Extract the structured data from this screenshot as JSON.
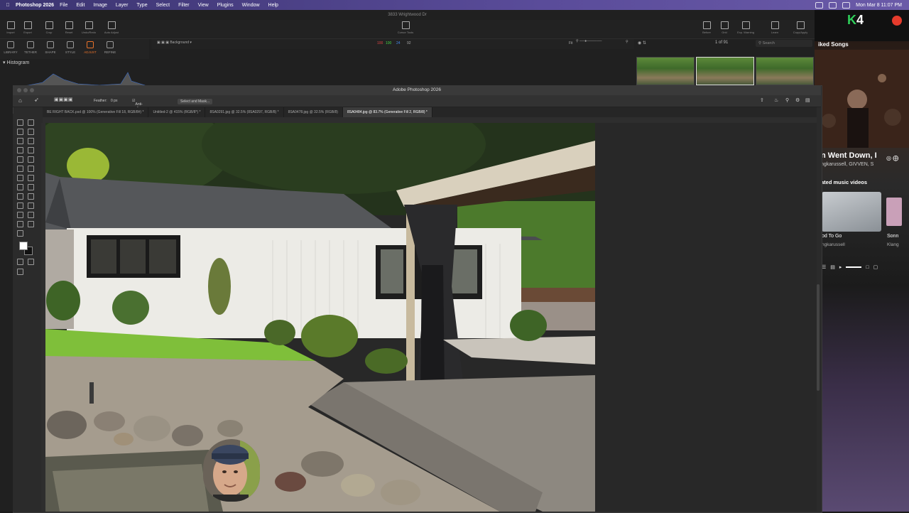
{
  "menubar": {
    "app_name": "Photoshop 2026",
    "items": [
      "File",
      "Edit",
      "Image",
      "Layer",
      "Type",
      "Select",
      "Filter",
      "View",
      "Plugins",
      "Window",
      "Help"
    ],
    "clock": "Mon Mar 8  11:07 PM"
  },
  "bg_app": {
    "title": "3833 Wrightwood Dr",
    "toolbar_left": [
      "Import",
      "Export",
      "Crop",
      "Reset",
      "Undo/Redo",
      "Auto Adjust"
    ],
    "toolbar_center": "Cursor Tools",
    "toolbar_right": [
      "Before",
      "Grid",
      "Exp. Warning",
      "Learn",
      "Copy/Apply"
    ],
    "tabs": [
      "LIBRARY",
      "TETHER",
      "SHAPE",
      "STYLE",
      "ADJUST",
      "REFINE"
    ],
    "active_tab": "ADJUST",
    "histogram_label": "Histogram",
    "layer_label": "Background",
    "rgb_readout": [
      "100",
      "100",
      "24",
      "92"
    ],
    "zoom_label": "Fit",
    "image_count": "1 of 91",
    "search_placeholder": "Search"
  },
  "music": {
    "counter": "4",
    "counter_prefix": "K",
    "section": "iked Songs",
    "song_title": "n Went Down, I",
    "song_artist": "ngkarussell, GIVVEN, S",
    "related_header": "ated music videos",
    "video1_title": "od To Go",
    "video1_artist": "ngkarussell",
    "video2_title": "Sonn",
    "video2_artist": "Klang"
  },
  "photoshop": {
    "window_title": "Adobe Photoshop 2026",
    "options": {
      "feather_label": "Feather:",
      "feather_value": "0 px",
      "antialias": "Anti-alias",
      "select_mask": "Select and Mask..."
    },
    "tabs": [
      "BE RIGHT BACK.psd @ 100% (Generative Fill 18, RGB/8#) *",
      "Untitled-2 @ 415% (RGB/8*) *",
      "8SA0291.jpg @ 32.5% (8SA0297, RGB/8) *",
      "8SA0478.jpg @ 32.5% (RGB/8)",
      "8SA0484.jpg @ 83.7% (Generative Fill 2, RGB/8) *"
    ],
    "active_tab_index": 4
  },
  "colors": {
    "accent": "#e8722a",
    "menubar": "#4a3f88",
    "music_counter": "#2fcf5a",
    "record": "#e53b2c"
  }
}
